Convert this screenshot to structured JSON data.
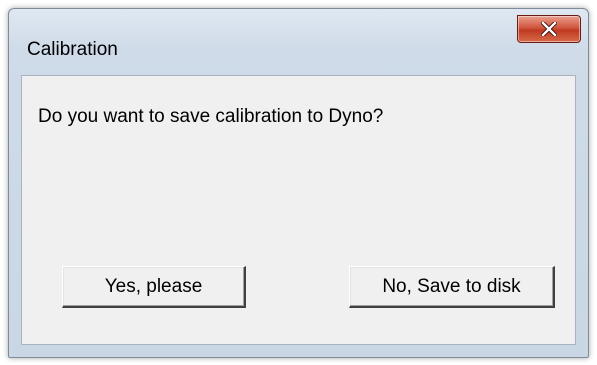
{
  "window": {
    "title": "Calibration",
    "close_icon": "close-icon"
  },
  "dialog": {
    "message": "Do you want to save calibration to Dyno?",
    "yes_label": "Yes, please",
    "no_label": "No, Save to disk"
  },
  "colors": {
    "close_button": "#c8452c",
    "frame": "#cfdbe8",
    "client": "#f0f0f0"
  }
}
